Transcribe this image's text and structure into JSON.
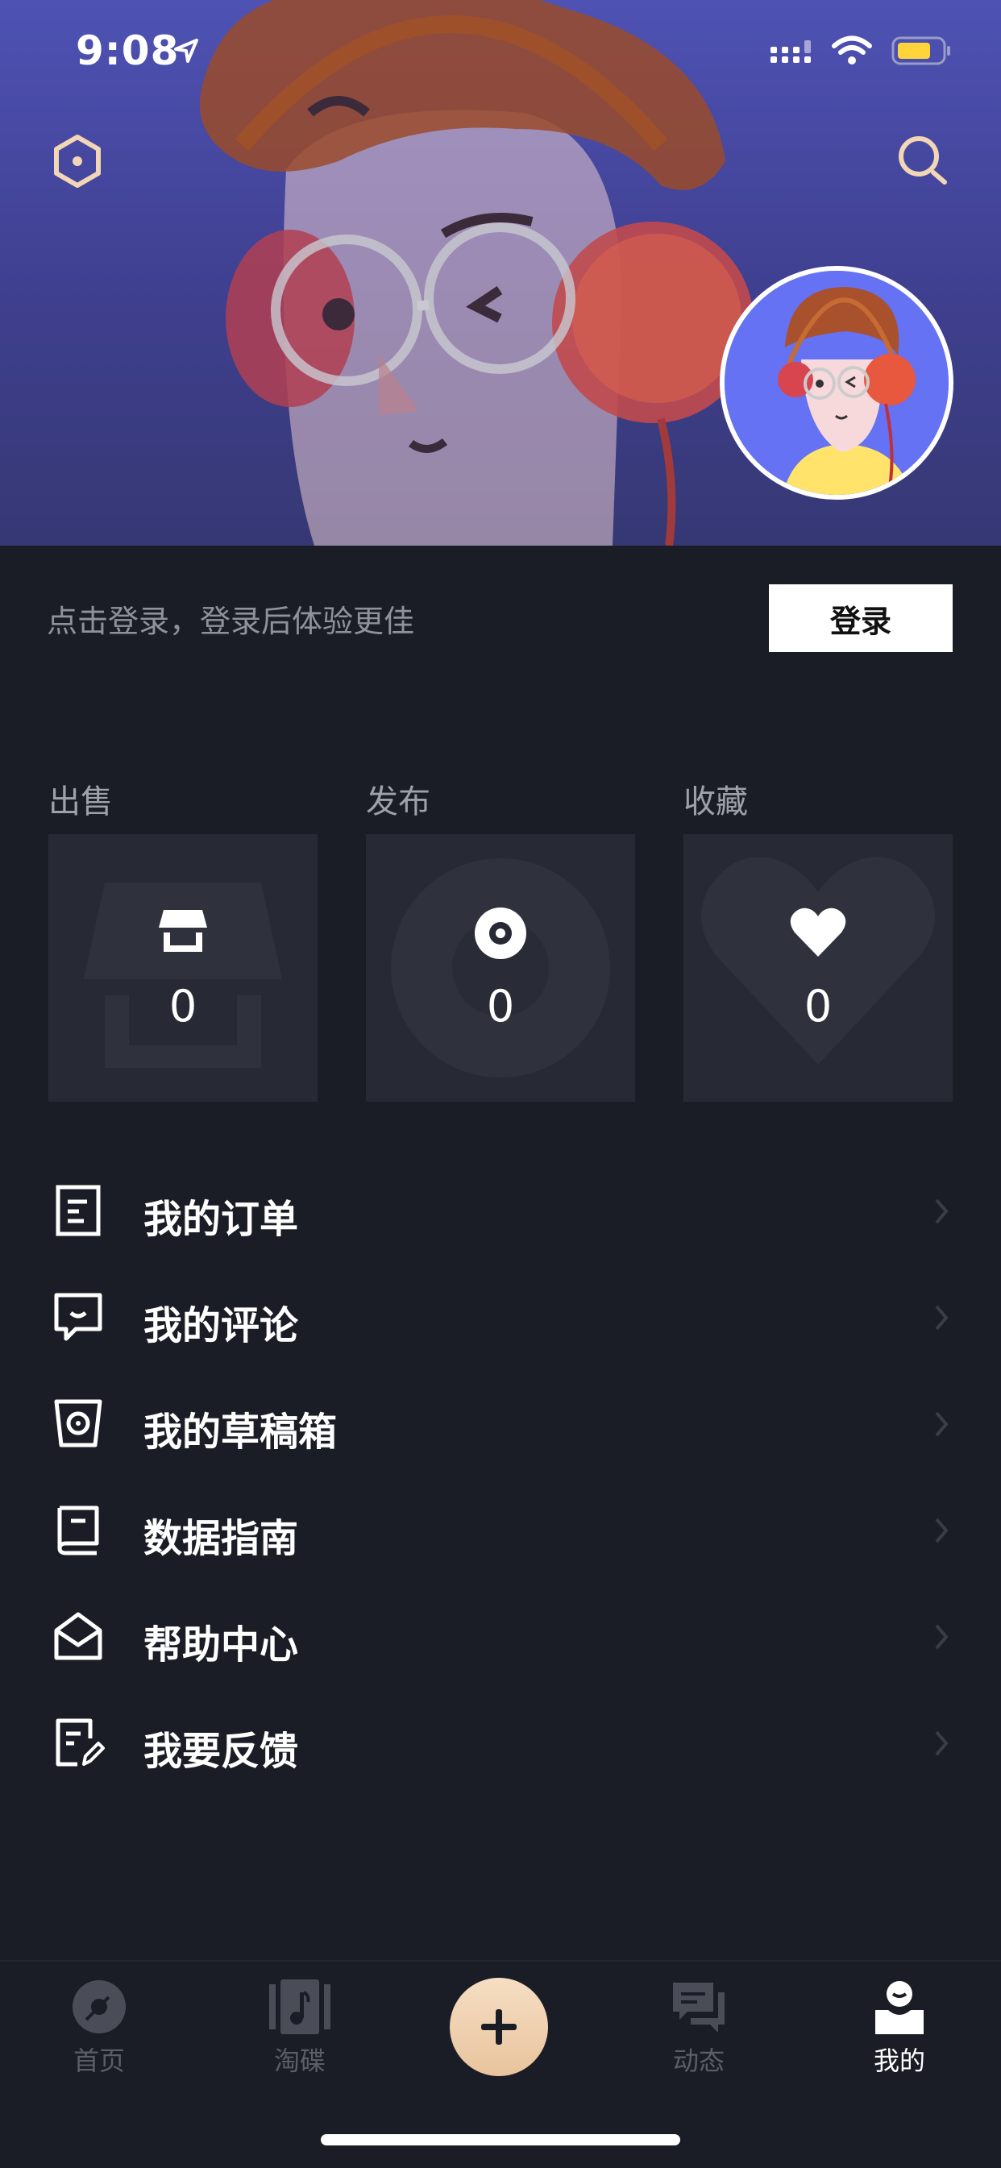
{
  "status_bar": {
    "time": "9:08"
  },
  "login": {
    "hint": "点击登录，登录后体验更佳",
    "button_label": "登录"
  },
  "stats": [
    {
      "label": "出售",
      "count": "0",
      "icon": "store-icon"
    },
    {
      "label": "发布",
      "count": "0",
      "icon": "record-icon"
    },
    {
      "label": "收藏",
      "count": "0",
      "icon": "heart-icon"
    }
  ],
  "menu": [
    {
      "label": "我的订单",
      "icon": "order-icon"
    },
    {
      "label": "我的评论",
      "icon": "comment-icon"
    },
    {
      "label": "我的草稿箱",
      "icon": "draft-icon"
    },
    {
      "label": "数据指南",
      "icon": "book-icon"
    },
    {
      "label": "帮助中心",
      "icon": "mail-open-icon"
    },
    {
      "label": "我要反馈",
      "icon": "feedback-icon"
    }
  ],
  "tabs": [
    {
      "label": "首页",
      "icon": "vinyl-icon",
      "active": false
    },
    {
      "label": "淘碟",
      "icon": "music-note-icon",
      "active": false
    },
    {
      "label": "",
      "icon": "plus-icon",
      "active": false
    },
    {
      "label": "动态",
      "icon": "chat-icon",
      "active": false
    },
    {
      "label": "我的",
      "icon": "user-icon",
      "active": true
    }
  ],
  "colors": {
    "background": "#1b1d26",
    "card": "#272a34",
    "hero": "#4e52b3",
    "accent": "#f2d6b5",
    "muted_text": "#8f929c"
  }
}
